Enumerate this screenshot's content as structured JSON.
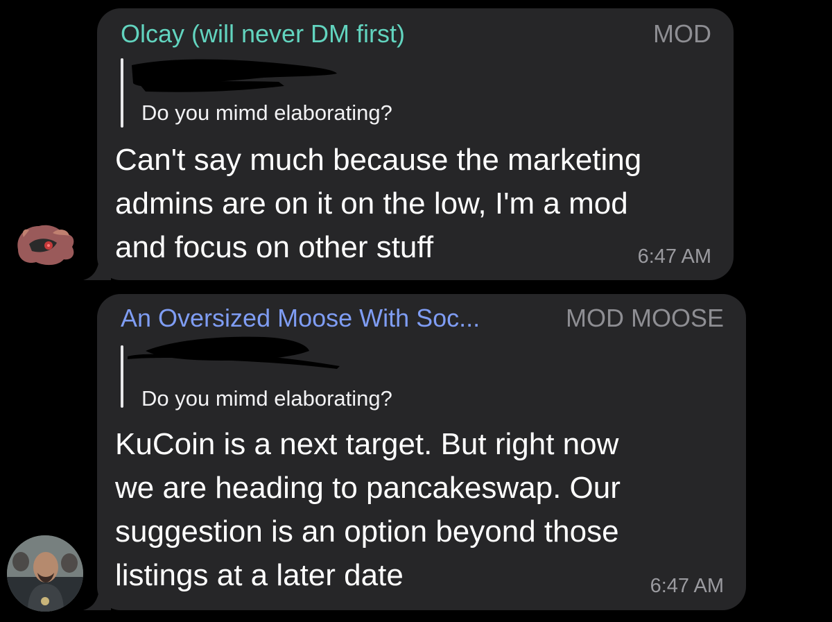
{
  "messages": [
    {
      "sender": "Olcay (will never DM first)",
      "role": "MOD",
      "reply_quote": "Do you mimd elaborating?",
      "body": "Can't say much because the marketing\nadmins are on it on the low, I'm a mod\nand focus on other stuff",
      "time": "6:47 AM",
      "sender_color": "#62d4bf",
      "avatar_icon": "robot-bird-icon"
    },
    {
      "sender": "An Oversized Moose With Soc...",
      "role": "MOD MOOSE",
      "reply_quote": "Do you mimd elaborating?",
      "body": "KuCoin is a next target. But right now\nwe are heading to pancakeswap. Our\nsuggestion is an option beyond those\nlistings at a later date",
      "time": "6:47 AM",
      "sender_color": "#7f9df4",
      "avatar_icon": "person-photo-icon"
    }
  ]
}
